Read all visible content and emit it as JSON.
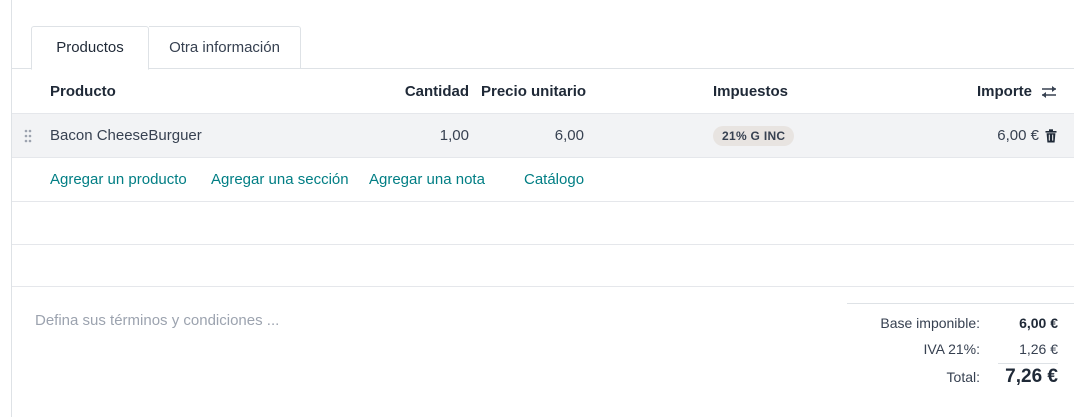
{
  "tabs": [
    {
      "label": "Productos",
      "active": true
    },
    {
      "label": "Otra información",
      "active": false
    }
  ],
  "table": {
    "headers": {
      "product": "Producto",
      "quantity": "Cantidad",
      "unit_price": "Precio unitario",
      "taxes": "Impuestos",
      "amount": "Importe"
    },
    "rows": [
      {
        "product": "Bacon CheeseBurguer",
        "quantity": "1,00",
        "unit_price": "6,00",
        "tax": "21% G INC",
        "amount": "6,00 €"
      }
    ]
  },
  "actions": {
    "add_product": "Agregar un producto",
    "add_section": "Agregar una sección",
    "add_note": "Agregar una nota",
    "catalog": "Catálogo"
  },
  "terms_placeholder": "Defina sus términos y condiciones ...",
  "totals": {
    "base_label": "Base imponible:",
    "base_value": "6,00 €",
    "tax_label": "IVA 21%:",
    "tax_value": "1,26 €",
    "total_label": "Total:",
    "total_value": "7,26 €"
  },
  "icons": {
    "drag": "drag-handle-icon",
    "delete": "trash-icon",
    "columns": "adjust-columns-icon"
  },
  "colors": {
    "link": "#017e84",
    "row_highlight": "#f2f3f5",
    "badge": "#e8e4e1"
  }
}
